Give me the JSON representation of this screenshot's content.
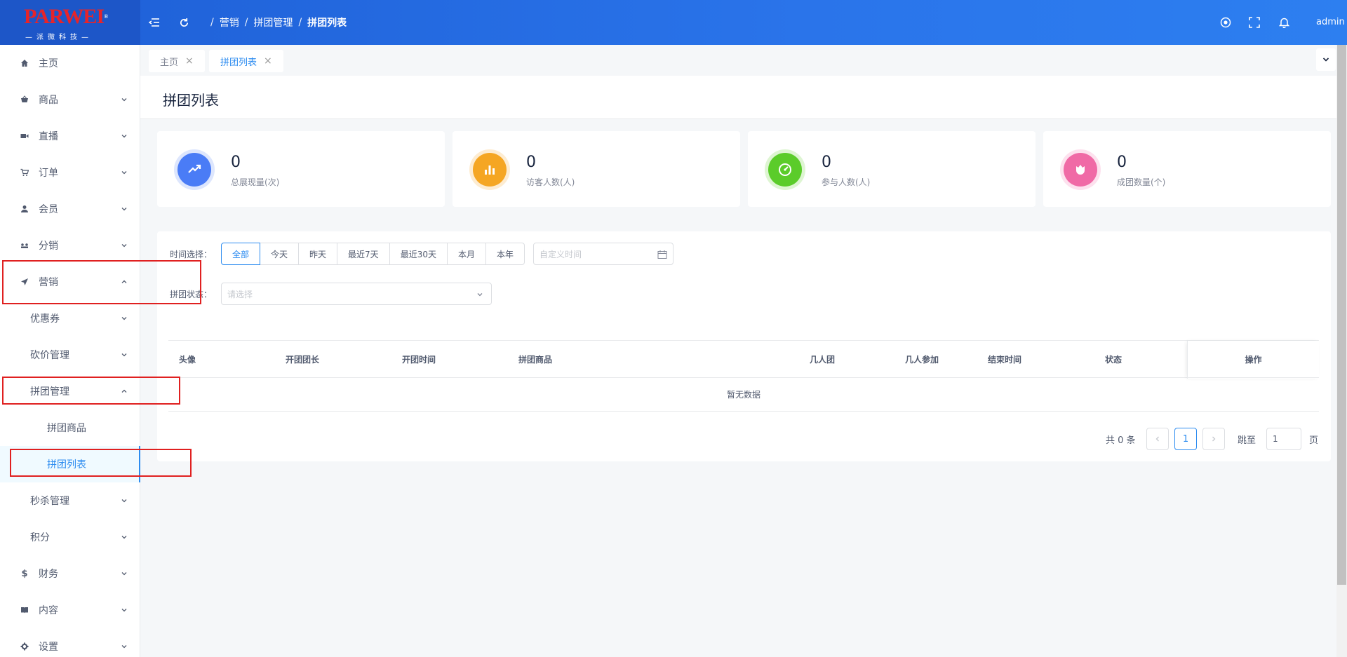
{
  "header": {
    "logo_text": "PARWEI",
    "logo_reg": "®",
    "logo_sub": "—派微科技—",
    "breadcrumb": [
      {
        "label": "/"
      },
      {
        "label": "营销"
      },
      {
        "label": "/"
      },
      {
        "label": "拼团管理"
      },
      {
        "label": "/"
      },
      {
        "label": "拼团列表"
      }
    ],
    "user": "admin",
    "icons": [
      "menu-fold-icon",
      "refresh-icon",
      "target-icon",
      "fullscreen-icon",
      "bell-icon"
    ]
  },
  "sidebar": {
    "items": [
      {
        "label": "主页",
        "icon": "home-icon"
      },
      {
        "label": "商品",
        "icon": "basket-icon"
      },
      {
        "label": "直播",
        "icon": "video-icon"
      },
      {
        "label": "订单",
        "icon": "cart-icon"
      },
      {
        "label": "会员",
        "icon": "user-icon"
      },
      {
        "label": "分销",
        "icon": "network-icon"
      },
      {
        "label": "营销",
        "icon": "send-icon"
      },
      {
        "label": "优惠券"
      },
      {
        "label": "砍价管理"
      },
      {
        "label": "拼团管理"
      },
      {
        "label": "拼团商品"
      },
      {
        "label": "拼团列表"
      },
      {
        "label": "秒杀管理"
      },
      {
        "label": "积分"
      },
      {
        "label": "财务",
        "icon": "dollar-icon"
      },
      {
        "label": "内容",
        "icon": "book-icon"
      },
      {
        "label": "设置",
        "icon": "gear-icon"
      }
    ]
  },
  "tabs": [
    {
      "label": "主页",
      "close": "×"
    },
    {
      "label": "拼团列表",
      "close": "×"
    }
  ],
  "page": {
    "title": "拼团列表"
  },
  "stats": [
    {
      "value": "0",
      "label": "总展现量(次)",
      "color": "#4a7cf6",
      "ring": "#dde6fd",
      "icon": "trend-up-icon"
    },
    {
      "value": "0",
      "label": "访客人数(人)",
      "color": "#f5a623",
      "ring": "#fdecd1",
      "icon": "bar-chart-icon"
    },
    {
      "value": "0",
      "label": "参与人数(人)",
      "color": "#5bcc2a",
      "ring": "#def5d2",
      "icon": "dashboard-icon"
    },
    {
      "value": "0",
      "label": "成团数量(个)",
      "color": "#f06aa6",
      "ring": "#fde1ee",
      "icon": "flower-icon"
    }
  ],
  "filters": {
    "time_label": "时间选择：",
    "time_options": [
      "全部",
      "今天",
      "昨天",
      "最近7天",
      "最近30天",
      "本月",
      "本年"
    ],
    "date_placeholder": "自定义时间",
    "status_label": "拼团状态：",
    "status_placeholder": "请选择"
  },
  "table": {
    "columns": [
      "头像",
      "开团团长",
      "开团时间",
      "拼团商品",
      "几人团",
      "几人参加",
      "结束时间",
      "状态"
    ],
    "action_column": "操作",
    "empty_text": "暂无数据"
  },
  "pagination": {
    "total_text": "共 0 条",
    "current_page": "1",
    "jump_label": "跳至",
    "jump_value": "1",
    "page_suffix": "页"
  }
}
